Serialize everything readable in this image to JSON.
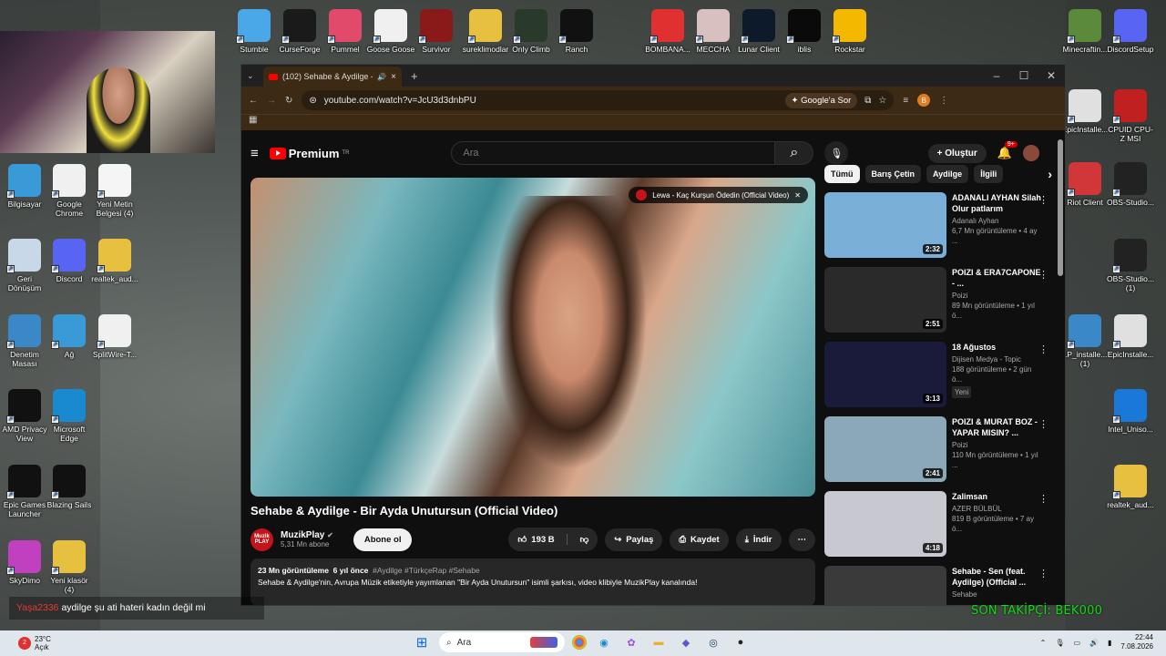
{
  "desktop": {
    "top_icons": [
      {
        "label": "Stumble",
        "color": "#4aa8e8"
      },
      {
        "label": "CurseForge",
        "color": "#1a1a1a"
      },
      {
        "label": "Pummel",
        "color": "#e14a6a"
      },
      {
        "label": "Goose Goose",
        "color": "#f0f0f0"
      },
      {
        "label": "Survivor",
        "color": "#8a1a1a"
      },
      {
        "label": "sureklimodlar",
        "color": "#e8c040"
      },
      {
        "label": "Only Climb",
        "color": "#2a3a2a"
      },
      {
        "label": "Ranch",
        "color": "#111111"
      },
      {
        "label": "BOMBANA...",
        "color": "#e03030"
      },
      {
        "label": "MECCHA",
        "color": "#d8c0c0"
      },
      {
        "label": "Lunar Client",
        "color": "#0d1a2a"
      },
      {
        "label": "iblis",
        "color": "#0a0a0a"
      },
      {
        "label": "Rockstar",
        "color": "#f5b800"
      }
    ],
    "left_icons": [
      {
        "label": "Bilgisayar",
        "color": "#3a9ad8"
      },
      {
        "label": "Google Chrome",
        "color": "#f0f0f0"
      },
      {
        "label": "Yeni Metin Belgesi (4)",
        "color": "#f5f5f5"
      },
      {
        "label": "Geri Dönüşüm",
        "color": "#c8d8e8"
      },
      {
        "label": "Discord",
        "color": "#5865f2"
      },
      {
        "label": "realtek_aud...",
        "color": "#e8c040"
      },
      {
        "label": "Denetim Masası",
        "color": "#3a88c8"
      },
      {
        "label": "Ağ",
        "color": "#3a9ad8"
      },
      {
        "label": "SplitWire-T...",
        "color": "#f0f0f0"
      },
      {
        "label": "AMD Privacy View",
        "color": "#111111"
      },
      {
        "label": "Microsoft Edge",
        "color": "#1a8ad0"
      },
      {
        "label": "Epic Games Launcher",
        "color": "#111111"
      },
      {
        "label": "Blazing Sails",
        "color": "#111111"
      },
      {
        "label": "SkyDimo",
        "color": "#c040c0"
      },
      {
        "label": "Yeni klasör (4)",
        "color": "#e8c040"
      }
    ],
    "right_icons": [
      {
        "label": "Minecraftin...",
        "color": "#5a8a3a"
      },
      {
        "label": "DiscordSetup",
        "color": "#5865f2"
      },
      {
        "label": "EpicInstalle...",
        "color": "#e0e0e0"
      },
      {
        "label": "CPUID CPU-Z MSI",
        "color": "#c02020"
      },
      {
        "label": "Riot Client",
        "color": "#d13639"
      },
      {
        "label": "OBS-Studio...",
        "color": "#222222"
      },
      {
        "label": "OBS-Studio... (1)",
        "color": "#222222"
      },
      {
        "label": "LP_installe... (1)",
        "color": "#3a88c8"
      },
      {
        "label": "EpicInstalle...",
        "color": "#e0e0e0"
      },
      {
        "label": "Intel_Uniso...",
        "color": "#1a78d8"
      },
      {
        "label": "realtek_aud...",
        "color": "#e8c040"
      }
    ]
  },
  "browser": {
    "tab_title": "(102) Sehabe & Aydilge - Bi",
    "url": "youtube.com/watch?v=JcU3d3dnbPU",
    "ask_google": "Google'a Sor",
    "profile_initial": "B"
  },
  "youtube": {
    "logo": "Premium",
    "logo_sup": "TR",
    "search_placeholder": "Ara",
    "create_label": "Oluştur",
    "notif_count": "9+",
    "miniplayer_label": "Lewa - Kaç Kurşun Ödedin (Official Video)",
    "video_title": "Sehabe & Aydilge - Bir Ayda Unutursun (Official Video)",
    "channel_name": "MuzikPlay",
    "channel_subs": "5,31 Mn abone",
    "avatar_text": "Muzik PLAY",
    "subscribe": "Abone ol",
    "likes": "193 B",
    "share": "Paylaş",
    "save": "Kaydet",
    "download": "İndir",
    "views": "23 Mn görüntüleme",
    "age": "6 yıl önce",
    "hashtags": "#Aydilge #TürkçeRap #Sehabe",
    "description": "Sehabe & Aydilge'nin, Avrupa Müzik etiketiyle yayımlanan \"Bir Ayda Unutursun\" isimli şarkısı, video klibiyle MuzikPlay kanalında!",
    "chips": [
      "Tümü",
      "Barış Çetin",
      "Aydilge",
      "İlgili"
    ],
    "related": [
      {
        "title": "ADANALI AYHAN Silah Olur patlarım",
        "channel": "Adanalı Ayhan",
        "meta": "6,7 Mn görüntüleme • 4 ay ...",
        "duration": "2:32",
        "badge": "",
        "thumb": "#7ab0d8"
      },
      {
        "title": "POIZI & ERA7CAPONE - ...",
        "channel": "Poizi",
        "meta": "89 Mn görüntüleme • 1 yıl ö...",
        "duration": "2:51",
        "badge": "",
        "thumb": "#2a2a2a"
      },
      {
        "title": "18 Ağustos",
        "channel": "Dijisen Medya - Topic",
        "meta": "188 görüntüleme • 2 gün ö...",
        "duration": "3:13",
        "badge": "Yeni",
        "thumb": "#1a1a3a"
      },
      {
        "title": "POIZI & MURAT BOZ - YAPAR MISIN? ...",
        "channel": "Poizi",
        "meta": "110 Mn görüntüleme • 1 yıl ...",
        "duration": "2:41",
        "badge": "",
        "thumb": "#8aa8b8"
      },
      {
        "title": "Zalimsan",
        "channel": "AZER BÜLBÜL",
        "meta": "819 B görüntüleme • 7 ay ö...",
        "duration": "4:18",
        "badge": "",
        "thumb": "#c8c8d0"
      },
      {
        "title": "Sehabe - Sen (feat. Aydilge) (Official ...",
        "channel": "Sehabe",
        "meta": "",
        "duration": "",
        "badge": "",
        "thumb": "#3a3a3a"
      }
    ]
  },
  "chat": {
    "nick": "Yaşa2336",
    "message": "aydilge şu ati hateri kadın değil mi"
  },
  "overlay": {
    "last_follower": "SON TAKİPÇİ: BEK000"
  },
  "taskbar": {
    "temp": "23°C",
    "weather": "Açık",
    "weather_badge": "2",
    "search_placeholder": "Ara",
    "time": "22:44",
    "date": "7.08.2026"
  }
}
